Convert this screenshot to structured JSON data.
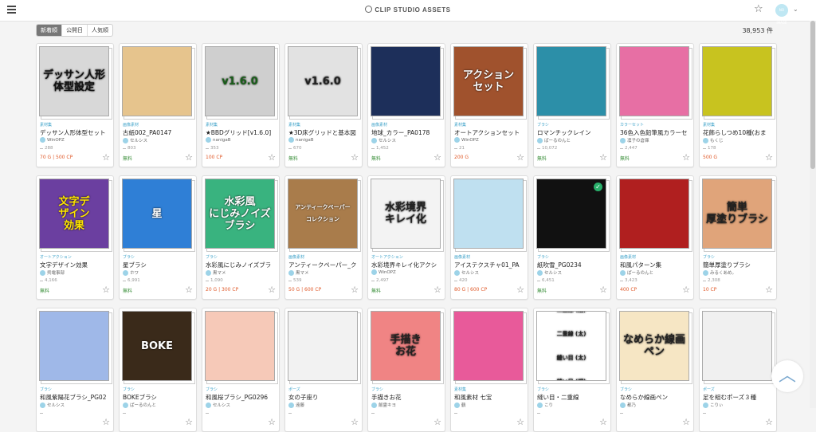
{
  "header": {
    "brand": "CLIP STUDIO ASSETS",
    "avatar_text": "NO IMAGE"
  },
  "sort_tabs": [
    "新着順",
    "公開日",
    "人気順"
  ],
  "result_count": "38,953 件",
  "cards": [
    {
      "thumb_text": "デッサン人形\n体型設定",
      "bg": "#d8d8d8",
      "fg": "#111",
      "category": "素材集",
      "title": "デッサン人形体型セット",
      "author": "WinOPZ",
      "downloads": "288",
      "price": "70 G | 500 CP",
      "free": false
    },
    {
      "thumb_text": "",
      "bg": "#e6c48d",
      "fg": "#fff",
      "category": "画像素材",
      "title": "古紙002_PA0147",
      "author": "セルシス",
      "downloads": "803",
      "price": "無料",
      "free": true
    },
    {
      "thumb_text": "v1.6.0",
      "bg": "#cfcfcf",
      "fg": "#1a5f1a",
      "category": "素材集",
      "title": "★BBDグリッド[v1.6.0]",
      "author": "nanigaB",
      "downloads": "353",
      "price": "100 CP",
      "free": false
    },
    {
      "thumb_text": "v1.6.0",
      "bg": "#e2e2e2",
      "fg": "#222",
      "category": "素材集",
      "title": "★3D床グリッドと基本図",
      "author": "nanigaB",
      "downloads": "670",
      "price": "無料",
      "free": true
    },
    {
      "thumb_text": "",
      "bg": "#1d2f5a",
      "fg": "#fff",
      "category": "画像素材",
      "title": "地球_カラー_PA0178",
      "author": "セルシス",
      "downloads": "1,452",
      "price": "無料",
      "free": true
    },
    {
      "thumb_text": "アクション\nセット",
      "bg": "#a0522d",
      "fg": "#fff",
      "category": "素材集",
      "title": "オートアクションセット",
      "author": "WinOPZ",
      "downloads": "21",
      "price": "200 G",
      "free": false
    },
    {
      "thumb_text": "",
      "bg": "#2c8fa8",
      "fg": "#fff",
      "category": "ブラシ",
      "title": "ロマンチックレイン",
      "author": "ぱーるのんと",
      "downloads": "10,072",
      "price": "無料",
      "free": true
    },
    {
      "thumb_text": "",
      "bg": "#e76fa4",
      "fg": "#fff",
      "category": "カラーセット",
      "title": "36色入色鉛筆風カラーセ",
      "author": "凛子の倉庫",
      "downloads": "2,447",
      "price": "無料",
      "free": true
    },
    {
      "thumb_text": "",
      "bg": "#c8c31f",
      "fg": "#fff",
      "category": "素材集",
      "title": "花飾らしつめ10種(おま",
      "author": "もくじ",
      "downloads": "178",
      "price": "500 G",
      "free": false
    },
    {
      "thumb_text": "文字デ\nザイン\n効果",
      "bg": "#6b3fa0",
      "fg": "#ffe600",
      "category": "オートアクション",
      "title": "文字デザイン効果",
      "author": "呉電事部",
      "downloads": "4,166",
      "price": "無料",
      "free": true
    },
    {
      "thumb_text": "星",
      "bg": "#2f7fd6",
      "fg": "#fff",
      "category": "ブラシ",
      "title": "星ブラシ",
      "author": "ホワ",
      "downloads": "6,991",
      "price": "無料",
      "free": true
    },
    {
      "thumb_text": "水彩風\nにじみノイズ\nブラシ",
      "bg": "#39b37f",
      "fg": "#fff",
      "category": "ブラシ",
      "title": "水彩風にじみノイズブラ",
      "author": "黒マメ",
      "downloads": "1,090",
      "price": "20 G | 300 CP",
      "free": false
    },
    {
      "thumb_text": "アンティークペーパー\nコレクション",
      "bg": "#a97c4b",
      "fg": "#fff",
      "category": "画像素材",
      "title": "アンティークペーパー_ク",
      "author": "黒マメ",
      "downloads": "539",
      "price": "50 G | 600 CP",
      "free": false
    },
    {
      "thumb_text": "水彩境界\nキレイ化",
      "bg": "#f3f3f3",
      "fg": "#222",
      "category": "オートアクション",
      "title": "水彩境界キレイ化アクシ",
      "author": "WinOPZ",
      "downloads": "2,497",
      "price": "無料",
      "free": true
    },
    {
      "thumb_text": "",
      "bg": "#bfe0f0",
      "fg": "#fff",
      "category": "画像素材",
      "title": "アイステクスチャ01_PA",
      "author": "セルシス",
      "downloads": "420",
      "price": "80 G | 600 CP",
      "free": false
    },
    {
      "thumb_text": "",
      "bg": "#111111",
      "fg": "#fff",
      "category": "ブラシ",
      "title": "紙吹雪_PG0234",
      "author": "セルシス",
      "downloads": "6,451",
      "price": "無料",
      "free": true
    },
    {
      "thumb_text": "",
      "bg": "#b01f1f",
      "fg": "#fff",
      "category": "画像素材",
      "title": "和風パターン集",
      "author": "ぱーるのんと",
      "downloads": "3,423",
      "price": "400 CP",
      "free": false
    },
    {
      "thumb_text": "簡単\n厚塗りブラシ",
      "bg": "#e0a47a",
      "fg": "#222",
      "category": "ブラシ",
      "title": "簡単厚塗りブラシ",
      "author": "みるくあめ。",
      "downloads": "2,308",
      "price": "10 CP",
      "free": false
    },
    {
      "thumb_text": "",
      "bg": "#9fb8e8",
      "fg": "#fff",
      "category": "ブラシ",
      "title": "和風紫陽花ブラシ_PG02",
      "author": "セルシス",
      "downloads": "",
      "price": "",
      "free": true
    },
    {
      "thumb_text": "BOKE",
      "bg": "#3a2a1a",
      "fg": "#fff",
      "category": "ブラシ",
      "title": "BOKEブラシ",
      "author": "ぱーるのんと",
      "downloads": "",
      "price": "",
      "free": true
    },
    {
      "thumb_text": "",
      "bg": "#f6c9b8",
      "fg": "#fff",
      "category": "ブラシ",
      "title": "和風桜ブラシ_PG0296",
      "author": "セルシス",
      "downloads": "",
      "price": "",
      "free": true
    },
    {
      "thumb_text": "",
      "bg": "#f2f2f2",
      "fg": "#fff",
      "category": "ポーズ",
      "title": "女の子座り",
      "author": "遠藤",
      "downloads": "",
      "price": "",
      "free": true
    },
    {
      "thumb_text": "手描き\nお花",
      "bg": "#f08484",
      "fg": "#222",
      "category": "ブラシ",
      "title": "手描きお花",
      "author": "飯霊キヨ",
      "downloads": "",
      "price": "",
      "free": true
    },
    {
      "thumb_text": "",
      "bg": "#e85a9a",
      "fg": "#fff",
      "category": "素材集",
      "title": "和風素材 七宝",
      "author": "鶴",
      "downloads": "",
      "price": "",
      "free": true
    },
    {
      "thumb_text": "二重線 (細)\n\n二重線 (太)\n\n縫い目 (太)\n\n縫い目 (細)",
      "bg": "#ffffff",
      "fg": "#222",
      "category": "ブラシ",
      "title": "縫い目・二重線",
      "author": "こり",
      "downloads": "",
      "price": "",
      "free": true
    },
    {
      "thumb_text": "なめらか線画ペン",
      "bg": "#f6e6c4",
      "fg": "#222",
      "category": "ブラシ",
      "title": "なめらか線画ペン",
      "author": "都乃",
      "downloads": "",
      "price": "",
      "free": true
    },
    {
      "thumb_text": "",
      "bg": "#f0f0f0",
      "fg": "#fff",
      "category": "ポーズ",
      "title": "足を組むポーズ３種",
      "author": "こりぃ",
      "downloads": "",
      "price": "",
      "free": true
    }
  ]
}
